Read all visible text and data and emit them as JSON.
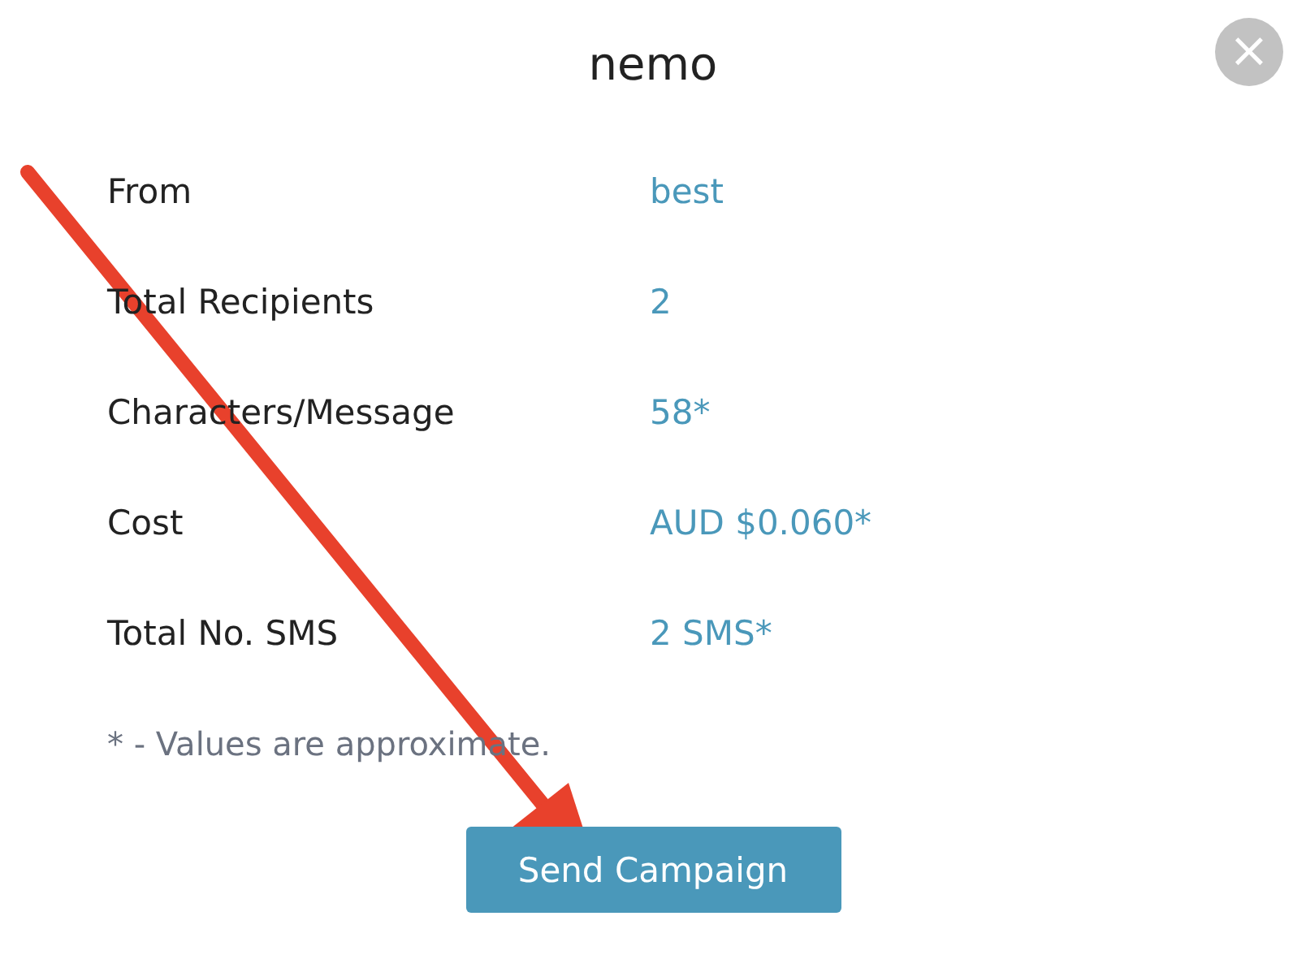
{
  "dialog": {
    "title": "nemo",
    "close_icon": "×",
    "rows": [
      {
        "label": "From",
        "value": "best"
      },
      {
        "label": "Total Recipients",
        "value": "2"
      },
      {
        "label": "Characters/Message",
        "value": "58*"
      },
      {
        "label": "Cost",
        "value": "AUD $0.060*"
      },
      {
        "label": "Total No. SMS",
        "value": "2 SMS*"
      }
    ],
    "footnote": "* - Values are approximate.",
    "button": "Send Campaign"
  }
}
